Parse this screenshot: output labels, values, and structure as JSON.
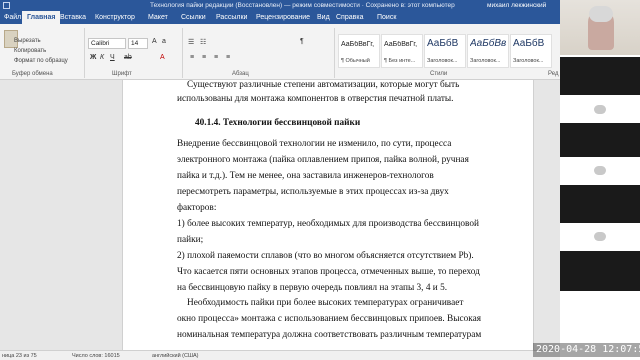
{
  "titlebar": {
    "doc_title": "Технология пайки редакции (Восстановлен) — режим совместимости · Сохранено в: этот компьютер",
    "user": "михаил лекжинский"
  },
  "tabs": [
    "Файл",
    "Главная",
    "Вставка",
    "Конструктор",
    "Макет",
    "Ссылки",
    "Рассылки",
    "Рецензирование",
    "Вид",
    "Справка",
    "Поиск"
  ],
  "ribbon": {
    "clipboard": {
      "cut": "Вырезать",
      "copy": "Копировать",
      "format_painter": "Формат по образцу",
      "label": "Буфер обмена"
    },
    "font": {
      "name": "Calibri",
      "size": "14",
      "label": "Шрифт"
    },
    "paragraph": {
      "label": "Абзац"
    },
    "styles": {
      "label": "Стили",
      "items": [
        {
          "sample": "АаБбВвГг,",
          "name": "¶ Обычный"
        },
        {
          "sample": "АаБбВвГг,",
          "name": "¶ Без инте..."
        },
        {
          "sample": "АаБбВ",
          "name": "Заголовок..."
        },
        {
          "sample": "АаБбВв",
          "name": "Заголовок..."
        },
        {
          "sample": "АаБбВ",
          "name": "Заголовок..."
        },
        {
          "sample": "АаБбВ",
          "name": "Заголовок..."
        }
      ]
    },
    "edit": {
      "label": "Ред"
    }
  },
  "document": {
    "lines": [
      "Существуют различные степени автоматизации, которые могут быть",
      "использованы для монтажа компонентов в отверстия печатной платы.",
      "40.1.4. Технологии бессвинцовой пайки",
      "Внедрение бессвинцовой технологии не изменило, по сути, процесса",
      "электронного  монтажа (пайка оплавлением припоя, пайка волной, ручная",
      "пайка и т.д.).  Тем не менее, она заставила инженеров-технологов",
      "пересмотреть параметры, используемые в этих процессах из-за двух",
      "факторов:",
      "1) более высоких температур, необходимых для производства бессвинцовой",
      "пайки;",
      "2) плохой паяемости сплавов (что во многом объясняется отсутствием Pb).",
      "Что касается пяти основных этапов процесса, отмеченных выше, то переход",
      "на бессвинцовую пайку в первую очередь повлиял на этапы 3, 4 и 5.",
      "Необходимость пайки при более высоких температурах ограничивает",
      "окно процесса» монтажа с использованием бессвинцовых припоев. Высокая",
      "номинальная температура должна соответствовать различным температурам"
    ]
  },
  "statusbar": {
    "page": "ница 23 из 75",
    "words": "Число слов: 16015",
    "lang": "английский (США)"
  },
  "overlay": {
    "datetime": "2020-04-28  12:07:53"
  }
}
